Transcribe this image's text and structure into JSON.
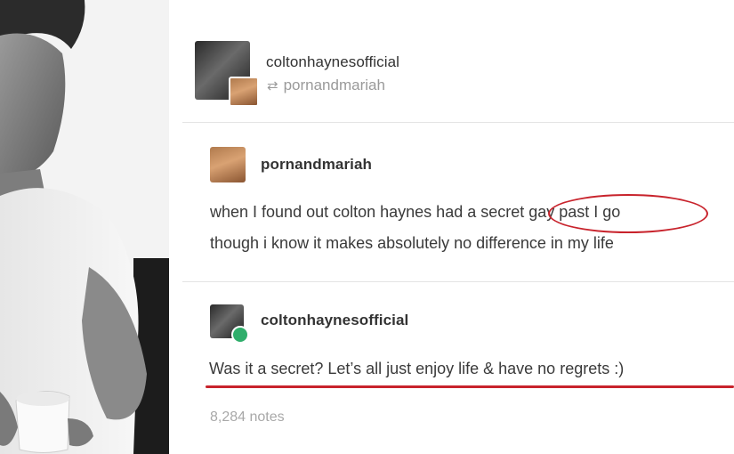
{
  "header": {
    "username": "coltonhaynesofficial",
    "reblogged_from": "pornandmariah"
  },
  "trail": [
    {
      "username": "pornandmariah",
      "line1": "when I found out colton haynes had a secret gay past I go",
      "line2": "though i know it makes absolutely no difference in my life"
    },
    {
      "username": "coltonhaynesofficial",
      "text": "Was it a secret? Let’s all just enjoy life & have no regrets :)"
    }
  ],
  "footer": {
    "notes": "8,284 notes"
  },
  "colors": {
    "annotation_red": "#c8232c",
    "text": "#3a3a3a",
    "muted": "#9a9a9a"
  },
  "icons": [
    "reblog-icon",
    "verified-badge-icon"
  ]
}
